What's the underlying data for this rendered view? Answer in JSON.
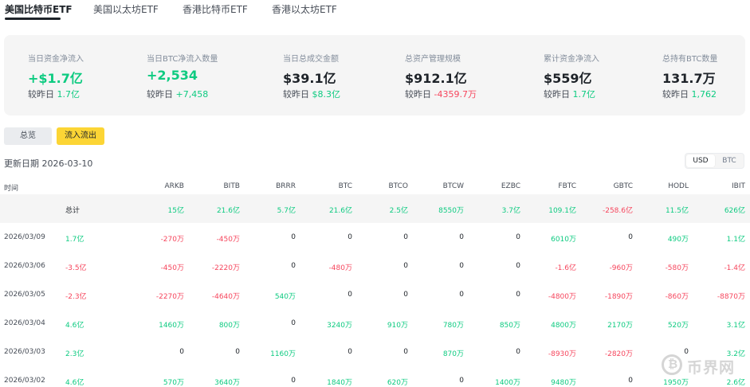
{
  "tabs": [
    {
      "label": "美国比特币ETF"
    },
    {
      "label": "美国以太坊ETF"
    },
    {
      "label": "香港比特币ETF"
    },
    {
      "label": "香港以太坊ETF"
    }
  ],
  "stats": [
    {
      "label": "当日资金净流入",
      "value": "+$1.7亿",
      "compare_prefix": "较昨日",
      "compare_value": "1.7亿"
    },
    {
      "label": "当日BTC净流入数量",
      "value": "+2,534",
      "compare_prefix": "较昨日",
      "compare_value": "+7,458"
    },
    {
      "label": "当日总成交金额",
      "value": "$39.1亿",
      "compare_prefix": "较昨日",
      "compare_value": "$8.3亿"
    },
    {
      "label": "总资产管理规模",
      "value": "$912.1亿",
      "compare_prefix": "较昨日",
      "compare_value": "-4359.7万"
    },
    {
      "label": "累计资金净流入",
      "value": "$559亿",
      "compare_prefix": "较昨日",
      "compare_value": "1.7亿"
    },
    {
      "label": "总持有BTC数量",
      "value": "131.7万",
      "compare_prefix": "较昨日",
      "compare_value": "1,762"
    }
  ],
  "view_tabs": {
    "overview": "总览",
    "flows": "流入流出"
  },
  "update": {
    "label": "更新日期",
    "date": "2026-03-10"
  },
  "unit_toggle": {
    "usd": "USD",
    "btc": "BTC"
  },
  "table": {
    "time_header": "时间",
    "columns": [
      "ARKB",
      "BITB",
      "BRRR",
      "BTC",
      "BTCO",
      "BTCW",
      "EZBC",
      "FBTC",
      "GBTC",
      "HODL",
      "IBIT"
    ],
    "total": {
      "label": "总计",
      "values": [
        "15亿",
        "21.6亿",
        "5.7亿",
        "21.6亿",
        "2.5亿",
        "8550万",
        "3.7亿",
        "109.1亿",
        "-258.6亿",
        "11.5亿",
        "626亿"
      ]
    },
    "rows": [
      {
        "date": "2026/03/09",
        "total": "1.7亿",
        "values": [
          "-270万",
          "-450万",
          "0",
          "0",
          "0",
          "0",
          "0",
          "6010万",
          "0",
          "490万",
          "1.1亿"
        ]
      },
      {
        "date": "2026/03/06",
        "total": "-3.5亿",
        "values": [
          "-450万",
          "-2220万",
          "0",
          "-480万",
          "0",
          "0",
          "0",
          "-1.6亿",
          "-960万",
          "-580万",
          "-1.4亿"
        ]
      },
      {
        "date": "2026/03/05",
        "total": "-2.3亿",
        "values": [
          "-2270万",
          "-4640万",
          "540万",
          "0",
          "0",
          "0",
          "0",
          "-4800万",
          "-1890万",
          "-860万",
          "-8870万"
        ]
      },
      {
        "date": "2026/03/04",
        "total": "4.6亿",
        "values": [
          "1460万",
          "800万",
          "0",
          "3240万",
          "910万",
          "780万",
          "850万",
          "4800万",
          "2170万",
          "520万",
          "3.1亿"
        ]
      },
      {
        "date": "2026/03/03",
        "total": "2.3亿",
        "values": [
          "0",
          "0",
          "1160万",
          "0",
          "0",
          "870万",
          "0",
          "-8930万",
          "-2820万",
          "0",
          "3.2亿"
        ]
      },
      {
        "date": "2026/03/02",
        "total": "4.6亿",
        "values": [
          "570万",
          "3640万",
          "0",
          "1840万",
          "620万",
          "0",
          "1400万",
          "9480万",
          "0",
          "1950万",
          "2.6亿"
        ]
      }
    ]
  },
  "watermark": {
    "text": "币界网"
  },
  "colors": {
    "up": "#0ecb81",
    "down": "#f6465d",
    "accent": "#fcd535"
  }
}
